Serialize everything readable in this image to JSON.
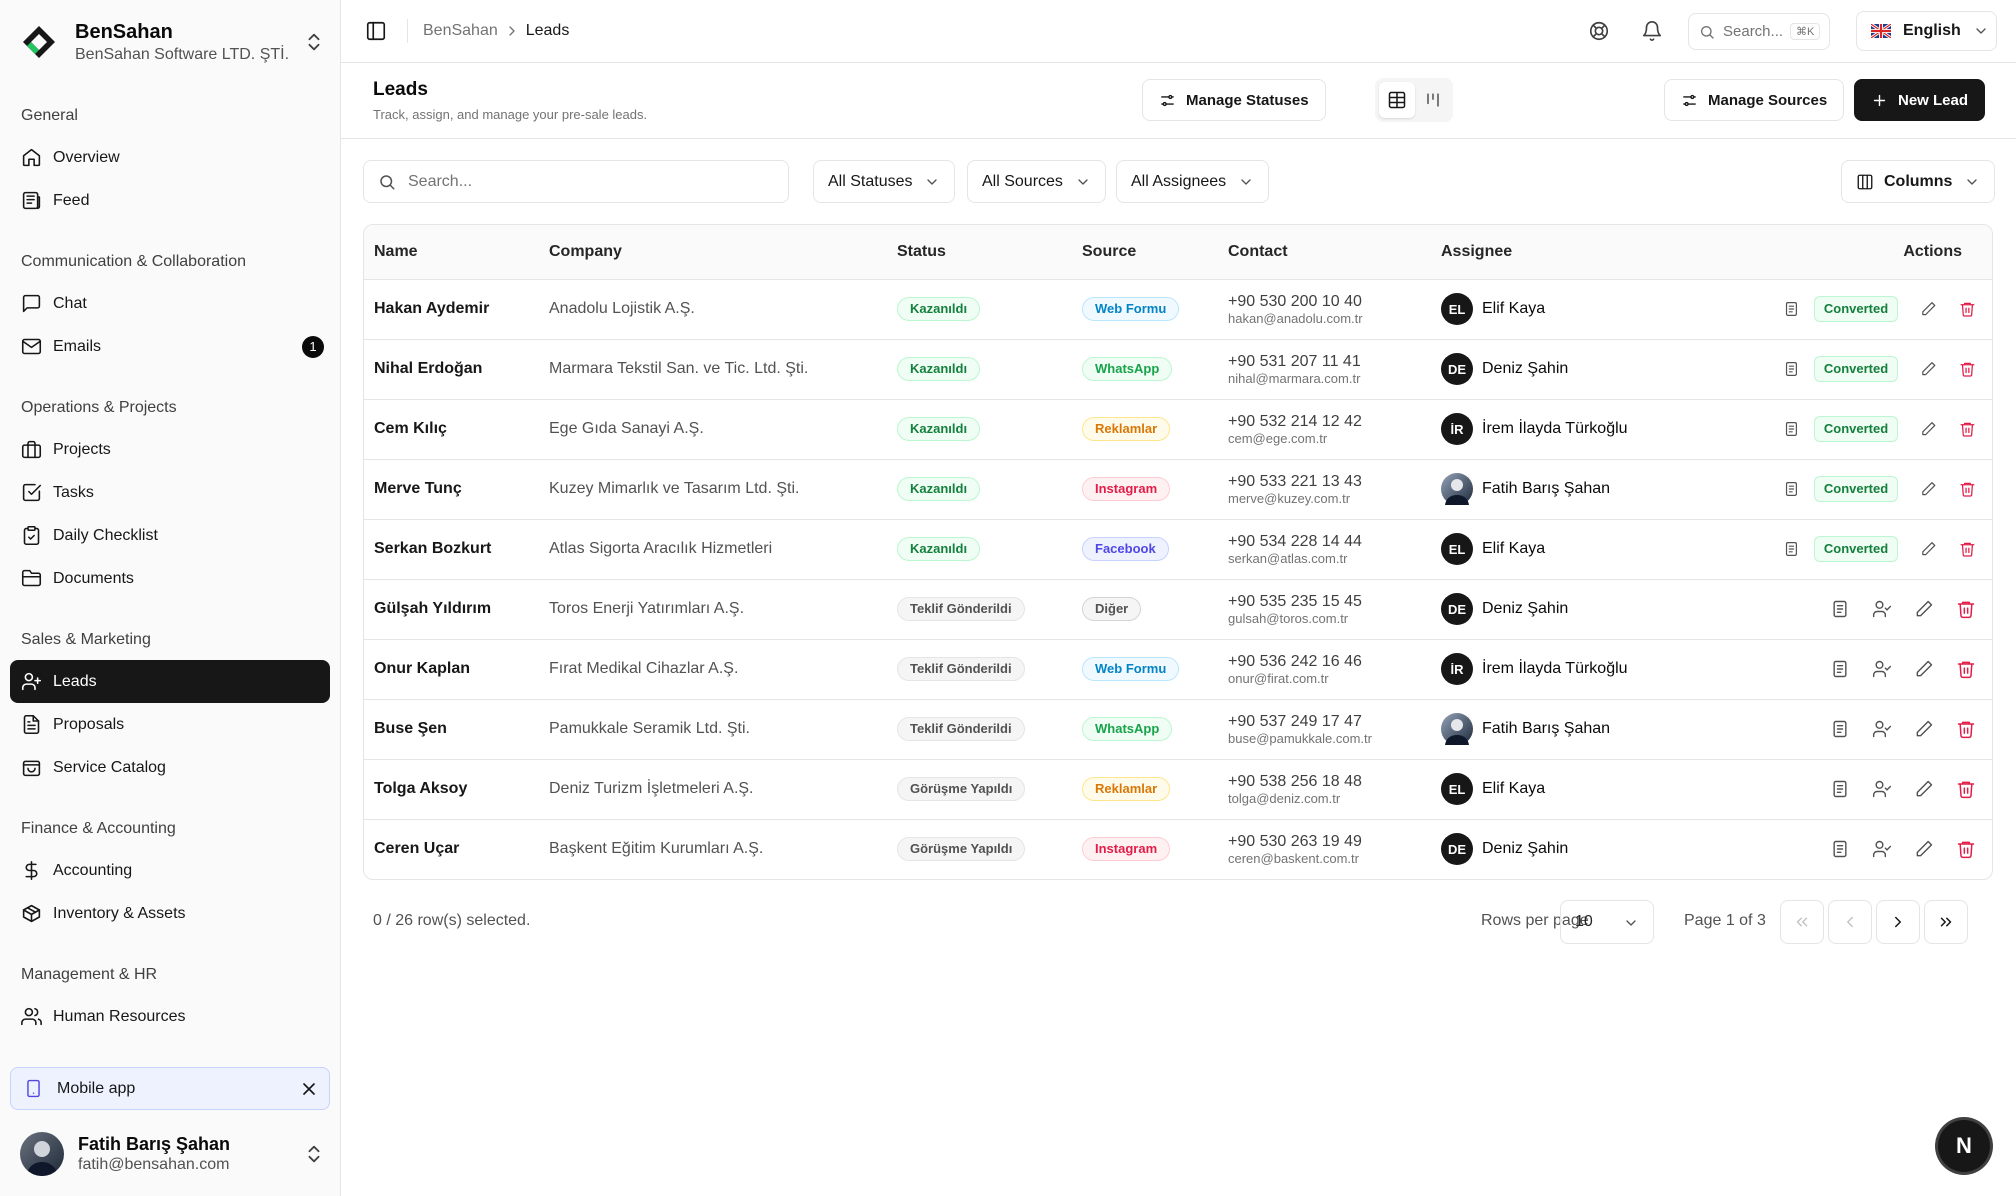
{
  "org": {
    "name": "BenSahan",
    "subtitle": "BenSahan Software LTD. ŞTİ."
  },
  "nav": {
    "general": {
      "title": "General",
      "items": [
        "Overview",
        "Feed"
      ]
    },
    "communication": {
      "title": "Communication & Collaboration",
      "items": [
        "Chat",
        "Emails"
      ],
      "emails_badge": "1"
    },
    "operations": {
      "title": "Operations & Projects",
      "items": [
        "Projects",
        "Tasks",
        "Daily Checklist",
        "Documents"
      ]
    },
    "sales": {
      "title": "Sales & Marketing",
      "items": [
        "Leads",
        "Proposals",
        "Service Catalog"
      ]
    },
    "finance": {
      "title": "Finance & Accounting",
      "items": [
        "Accounting",
        "Inventory & Assets"
      ]
    },
    "management": {
      "title": "Management & HR",
      "items": [
        "Human Resources"
      ]
    }
  },
  "mobile_app": {
    "label": "Mobile app"
  },
  "user": {
    "name": "Fatih Barış Şahan",
    "email": "fatih@bensahan.com"
  },
  "topbar": {
    "breadcrumb": [
      "BenSahan",
      "Leads"
    ],
    "search_placeholder": "Search...",
    "search_shortcut": "⌘K",
    "language": "English"
  },
  "page": {
    "title": "Leads",
    "subtitle": "Track, assign, and manage your pre-sale leads.",
    "manage_statuses": "Manage Statuses",
    "manage_sources": "Manage Sources",
    "new_lead": "New Lead"
  },
  "filters": {
    "search_placeholder": "Search...",
    "statuses": "All Statuses",
    "sources": "All Sources",
    "assignees": "All Assignees",
    "columns": "Columns"
  },
  "table": {
    "headers": [
      "Name",
      "Company",
      "Status",
      "Source",
      "Contact",
      "Assignee",
      "Actions"
    ],
    "converted_label": "Converted",
    "rows": [
      {
        "name": "Hakan Aydemir",
        "company": "Anadolu Lojistik A.Ş.",
        "status": "Kazanıldı",
        "source": "Web Formu",
        "phone": "+90 530 200 10 40",
        "email": "hakan@anadolu.com.tr",
        "assignee_initials": "EL",
        "assignee": "Elif Kaya"
      },
      {
        "name": "Nihal Erdoğan",
        "company": "Marmara Tekstil San. ve Tic. Ltd. Şti.",
        "status": "Kazanıldı",
        "source": "WhatsApp",
        "phone": "+90 531 207 11 41",
        "email": "nihal@marmara.com.tr",
        "assignee_initials": "DE",
        "assignee": "Deniz Şahin"
      },
      {
        "name": "Cem Kılıç",
        "company": "Ege Gıda Sanayi A.Ş.",
        "status": "Kazanıldı",
        "source": "Reklamlar",
        "phone": "+90 532 214 12 42",
        "email": "cem@ege.com.tr",
        "assignee_initials": "İR",
        "assignee": "İrem İlayda Türkoğlu"
      },
      {
        "name": "Merve Tunç",
        "company": "Kuzey Mimarlık ve Tasarım Ltd. Şti.",
        "status": "Kazanıldı",
        "source": "Instagram",
        "phone": "+90 533 221 13 43",
        "email": "merve@kuzey.com.tr",
        "assignee_initials": "",
        "assignee": "Fatih Barış Şahan"
      },
      {
        "name": "Serkan Bozkurt",
        "company": "Atlas Sigorta Aracılık Hizmetleri",
        "status": "Kazanıldı",
        "source": "Facebook",
        "phone": "+90 534 228 14 44",
        "email": "serkan@atlas.com.tr",
        "assignee_initials": "EL",
        "assignee": "Elif Kaya"
      },
      {
        "name": "Gülşah Yıldırım",
        "company": "Toros Enerji Yatırımları A.Ş.",
        "status": "Teklif Gönderildi",
        "source": "Diğer",
        "phone": "+90 535 235 15 45",
        "email": "gulsah@toros.com.tr",
        "assignee_initials": "DE",
        "assignee": "Deniz Şahin"
      },
      {
        "name": "Onur Kaplan",
        "company": "Fırat Medikal Cihazlar A.Ş.",
        "status": "Teklif Gönderildi",
        "source": "Web Formu",
        "phone": "+90 536 242 16 46",
        "email": "onur@firat.com.tr",
        "assignee_initials": "İR",
        "assignee": "İrem İlayda Türkoğlu"
      },
      {
        "name": "Buse Şen",
        "company": "Pamukkale Seramik Ltd. Şti.",
        "status": "Teklif Gönderildi",
        "source": "WhatsApp",
        "phone": "+90 537 249 17 47",
        "email": "buse@pamukkale.com.tr",
        "assignee_initials": "",
        "assignee": "Fatih Barış Şahan"
      },
      {
        "name": "Tolga Aksoy",
        "company": "Deniz Turizm İşletmeleri A.Ş.",
        "status": "Görüşme Yapıldı",
        "source": "Reklamlar",
        "phone": "+90 538 256 18 48",
        "email": "tolga@deniz.com.tr",
        "assignee_initials": "EL",
        "assignee": "Elif Kaya"
      },
      {
        "name": "Ceren Uçar",
        "company": "Başkent Eğitim Kurumları A.Ş.",
        "status": "Görüşme Yapıldı",
        "source": "Instagram",
        "phone": "+90 530 263 19 49",
        "email": "ceren@baskent.com.tr",
        "assignee_initials": "DE",
        "assignee": "Deniz Şahin"
      }
    ]
  },
  "status_colors": {
    "Kazanıldı": {
      "fg": "#15803d",
      "bg": "#f0fdf4",
      "border": "#bbf7d0"
    },
    "Teklif Gönderildi": {
      "fg": "#525252",
      "bg": "#f5f5f5",
      "border": "#e5e5e5"
    },
    "Görüşme Yapıldı": {
      "fg": "#525252",
      "bg": "#f5f5f5",
      "border": "#e5e5e5"
    }
  },
  "source_colors": {
    "Web Formu": {
      "fg": "#0284c7",
      "bg": "#f0f9ff",
      "border": "#bae6fd"
    },
    "WhatsApp": {
      "fg": "#16a34a",
      "bg": "#f0fdf4",
      "border": "#bbf7d0"
    },
    "Reklamlar": {
      "fg": "#d97706",
      "bg": "#fffbeb",
      "border": "#fde68a"
    },
    "Instagram": {
      "fg": "#e11d48",
      "bg": "#fff1f2",
      "border": "#fecdd3"
    },
    "Facebook": {
      "fg": "#4f46e5",
      "bg": "#eef2ff",
      "border": "#c7d2fe"
    },
    "Diğer": {
      "fg": "#525252",
      "bg": "#f5f5f5",
      "border": "#d4d4d4"
    }
  },
  "footer": {
    "selected": "0 / 26 row(s) selected.",
    "rows_per_page_label": "Rows per page",
    "rows_per_page": "10",
    "page_info": "Page 1 of 3"
  },
  "fab": {
    "label": "N"
  }
}
